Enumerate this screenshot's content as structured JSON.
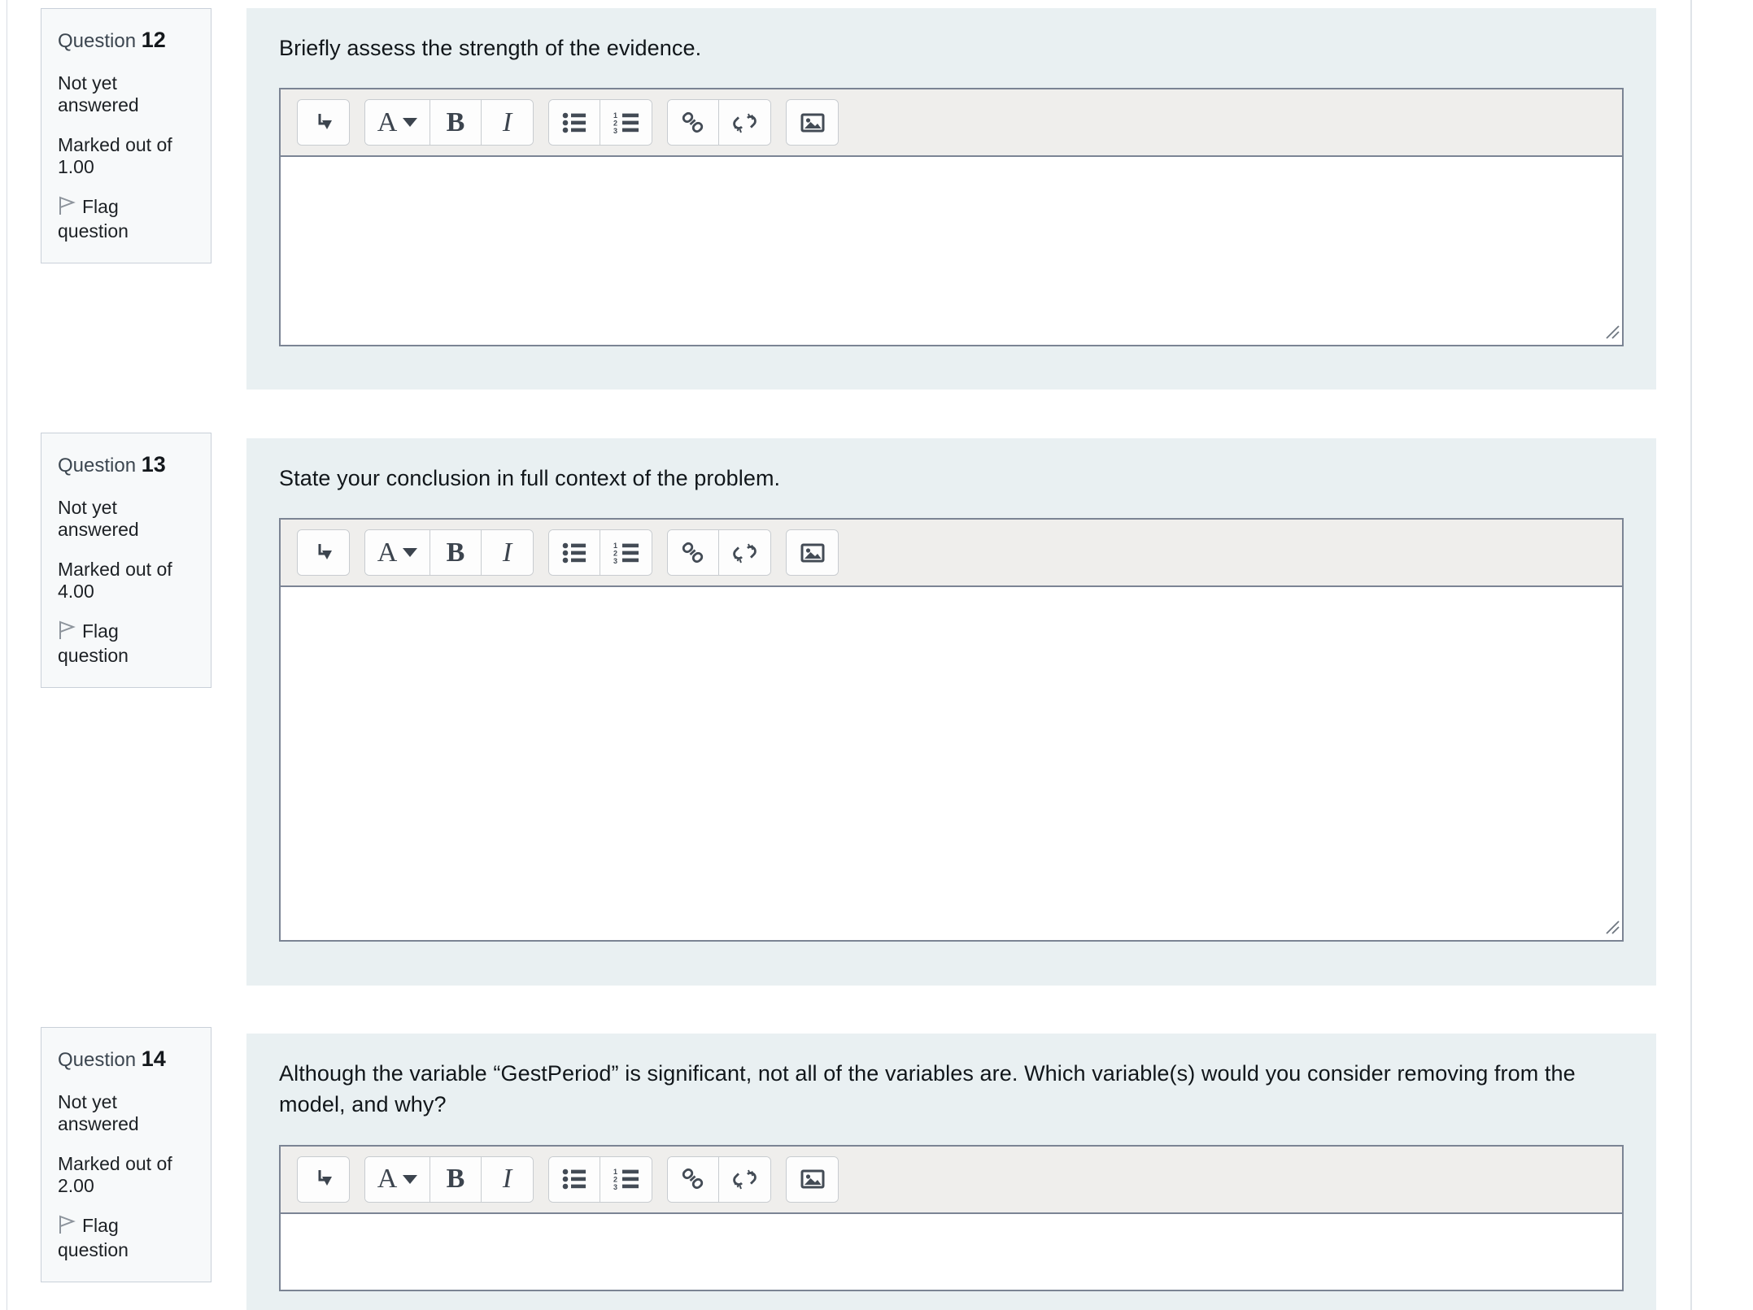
{
  "page": {
    "background": "#ffffff",
    "content_background": "#e9f0f2",
    "info_background": "#f7f9fa",
    "border_color": "#7b8494"
  },
  "toolbar": {
    "buttons": [
      {
        "name": "expand-toolbar-icon",
        "label": "⤵",
        "title": "Show more buttons"
      },
      {
        "name": "font-style-icon",
        "label": "A",
        "title": "Paragraph styles"
      },
      {
        "name": "bold-icon",
        "label": "B",
        "title": "Bold"
      },
      {
        "name": "italic-icon",
        "label": "I",
        "title": "Italic"
      },
      {
        "name": "bullet-list-icon",
        "label": "",
        "title": "Unordered list"
      },
      {
        "name": "numbered-list-icon",
        "label": "",
        "title": "Ordered list"
      },
      {
        "name": "link-icon",
        "label": "",
        "title": "Link"
      },
      {
        "name": "unlink-icon",
        "label": "",
        "title": "Unlink"
      },
      {
        "name": "image-icon",
        "label": "",
        "title": "Image"
      }
    ]
  },
  "questions": [
    {
      "label": "Question",
      "number": "12",
      "status": "Not yet answered",
      "marked_out_of": "Marked out of 1.00",
      "flag_label": "Flag question",
      "text": "Briefly assess the strength of the evidence.",
      "answer_value": ""
    },
    {
      "label": "Question",
      "number": "13",
      "status": "Not yet answered",
      "marked_out_of": "Marked out of 4.00",
      "flag_label": "Flag question",
      "text": "State your conclusion in full context of the problem.",
      "answer_value": ""
    },
    {
      "label": "Question",
      "number": "14",
      "status": "Not yet answered",
      "marked_out_of": "Marked out of 2.00",
      "flag_label": "Flag question",
      "text": "Although the variable “GestPeriod” is significant, not all of the variables are. Which variable(s) would you consider removing from the model, and why?",
      "answer_value": ""
    }
  ]
}
